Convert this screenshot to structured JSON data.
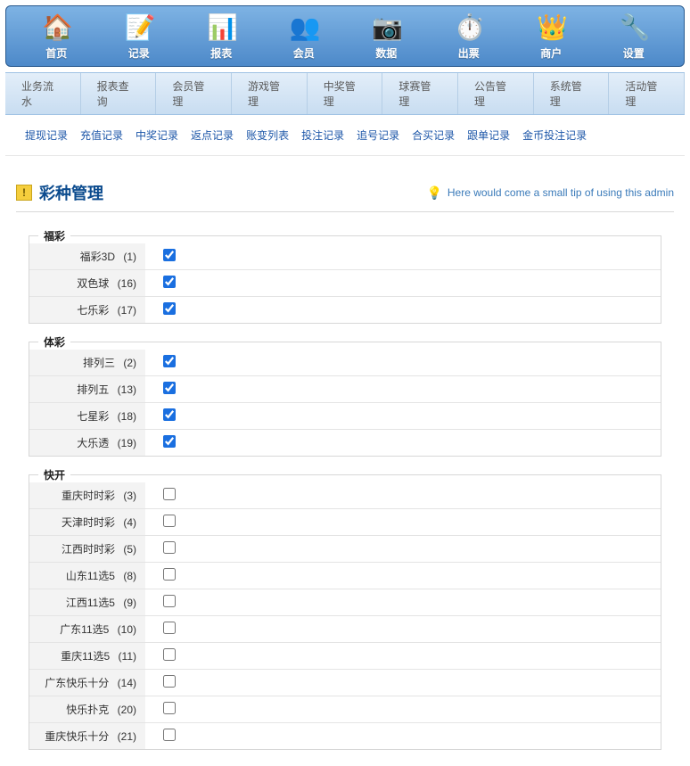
{
  "topnav": [
    {
      "label": "首页",
      "icon": "🏠"
    },
    {
      "label": "记录",
      "icon": "📝"
    },
    {
      "label": "报表",
      "icon": "📊"
    },
    {
      "label": "会员",
      "icon": "👥"
    },
    {
      "label": "数据",
      "icon": "📷"
    },
    {
      "label": "出票",
      "icon": "⏱️"
    },
    {
      "label": "商户",
      "icon": "👑"
    },
    {
      "label": "设置",
      "icon": "🔧"
    }
  ],
  "submenu": [
    "业务流水",
    "报表查询",
    "会员管理",
    "游戏管理",
    "中奖管理",
    "球赛管理",
    "公告管理",
    "系统管理",
    "活动管理"
  ],
  "links": [
    "提现记录",
    "充值记录",
    "中奖记录",
    "返点记录",
    "账变列表",
    "投注记录",
    "追号记录",
    "合买记录",
    "跟单记录",
    "金币投注记录"
  ],
  "page": {
    "title": "彩种管理",
    "tip": "Here would come a small tip of using this admin"
  },
  "groups": [
    {
      "title": "福彩",
      "rows": [
        {
          "name": "福彩3D",
          "id": 1,
          "checked": true
        },
        {
          "name": "双色球",
          "id": 16,
          "checked": true
        },
        {
          "name": "七乐彩",
          "id": 17,
          "checked": true
        }
      ]
    },
    {
      "title": "体彩",
      "rows": [
        {
          "name": "排列三",
          "id": 2,
          "checked": true
        },
        {
          "name": "排列五",
          "id": 13,
          "checked": true
        },
        {
          "name": "七星彩",
          "id": 18,
          "checked": true
        },
        {
          "name": "大乐透",
          "id": 19,
          "checked": true
        }
      ]
    },
    {
      "title": "快开",
      "rows": [
        {
          "name": "重庆时时彩",
          "id": 3,
          "checked": false
        },
        {
          "name": "天津时时彩",
          "id": 4,
          "checked": false
        },
        {
          "name": "江西时时彩",
          "id": 5,
          "checked": false
        },
        {
          "name": "山东11选5",
          "id": 8,
          "checked": false
        },
        {
          "name": "江西11选5",
          "id": 9,
          "checked": false
        },
        {
          "name": "广东11选5",
          "id": 10,
          "checked": false
        },
        {
          "name": "重庆11选5",
          "id": 11,
          "checked": false
        },
        {
          "name": "广东快乐十分",
          "id": 14,
          "checked": false
        },
        {
          "name": "快乐扑克",
          "id": 20,
          "checked": false
        },
        {
          "name": "重庆快乐十分",
          "id": 21,
          "checked": false
        }
      ]
    }
  ]
}
